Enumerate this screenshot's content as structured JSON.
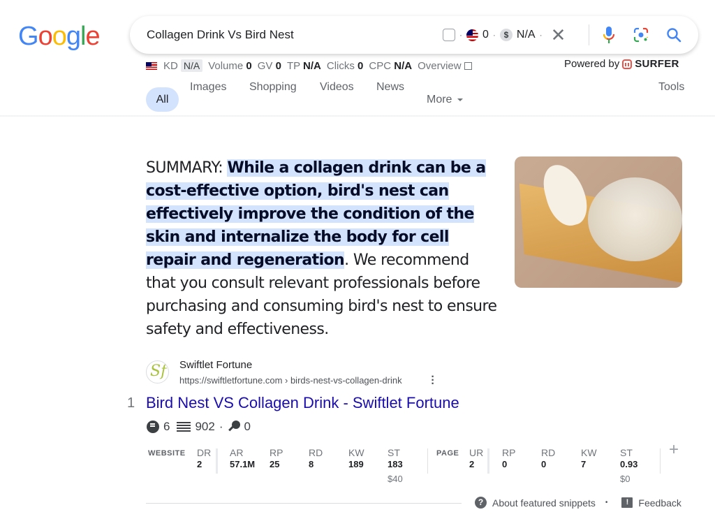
{
  "logo": {
    "letters": [
      {
        "char": "G",
        "color": "#4285f4"
      },
      {
        "char": "o",
        "color": "#ea4335"
      },
      {
        "char": "o",
        "color": "#fbbc05"
      },
      {
        "char": "g",
        "color": "#4285f4"
      },
      {
        "char": "l",
        "color": "#34a853"
      },
      {
        "char": "e",
        "color": "#ea4335"
      }
    ]
  },
  "search": {
    "query": "Collagen Drink Vs Bird Nest",
    "flag_count": "0",
    "cpc_value": "N/A",
    "dollar_icon": "$",
    "separator": "·",
    "clear_icon": "✕"
  },
  "metrics": {
    "kd_label": "KD",
    "kd_value": "N/A",
    "volume_label": "Volume",
    "volume_value": "0",
    "gv_label": "GV",
    "gv_value": "0",
    "tp_label": "TP",
    "tp_value": "N/A",
    "clicks_label": "Clicks",
    "clicks_value": "0",
    "cpc_label": "CPC",
    "cpc_value": "N/A",
    "overview_label": "Overview"
  },
  "powered_by": {
    "label": "Powered by",
    "brand": "SURFER",
    "brand_color": "#e8534a"
  },
  "tabs": {
    "all": "All",
    "images": "Images",
    "shopping": "Shopping",
    "videos": "Videos",
    "news": "News",
    "more": "More",
    "tools": "Tools"
  },
  "snippet": {
    "prefix": "SUMMARY: ",
    "highlighted": "While a collagen drink can be a cost-effective option, bird's nest can effectively improve the condition of the skin and internalize the body for cell repair and regeneration",
    "rest": ". We recommend that you consult relevant professionals before purchasing and consuming bird's nest to ensure safety and effectiveness.",
    "highlight_color": "#d3e3fd"
  },
  "result": {
    "index": "1",
    "favicon_text": "Sf",
    "site_name": "Swiftlet Fortune",
    "url": "https://swiftletfortune.com › birds-nest-vs-collagen-drink",
    "title": "Bird Nest VS Collagen Drink - Swiftlet Fortune",
    "title_color": "#1a0dab",
    "stats": {
      "comments": "6",
      "words": "902",
      "keywords": "0",
      "separator": "·"
    }
  },
  "ahrefs": {
    "website": {
      "label": "WEBSITE",
      "dr": {
        "h": "DR",
        "v": "2"
      },
      "cols": [
        {
          "h": "AR",
          "v": "57.1M"
        },
        {
          "h": "RP",
          "v": "25"
        },
        {
          "h": "RD",
          "v": "8"
        },
        {
          "h": "KW",
          "v": "189"
        },
        {
          "h": "ST",
          "v": "183",
          "s": "$40"
        }
      ]
    },
    "page": {
      "label": "PAGE",
      "ur": {
        "h": "UR",
        "v": "2"
      },
      "cols": [
        {
          "h": "RP",
          "v": "0"
        },
        {
          "h": "RD",
          "v": "0"
        },
        {
          "h": "KW",
          "v": "7"
        },
        {
          "h": "ST",
          "v": "0.93",
          "s": "$0"
        }
      ]
    },
    "add_icon": "+"
  },
  "footer": {
    "about_icon": "?",
    "about_label": "About featured snippets",
    "bullet": "•",
    "feedback_icon": "!",
    "feedback_label": "Feedback"
  }
}
